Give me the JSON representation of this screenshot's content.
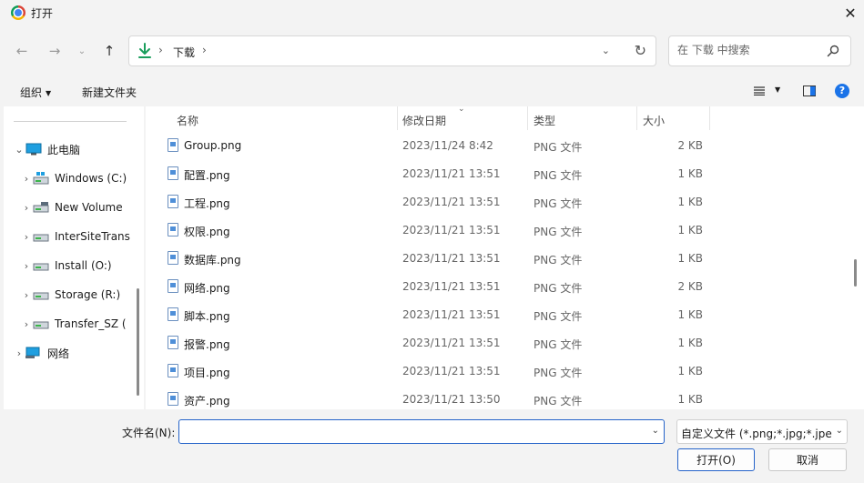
{
  "window": {
    "title": "打开"
  },
  "address": {
    "path": [
      "下载"
    ]
  },
  "search": {
    "placeholder": "在 下载 中搜索"
  },
  "toolbar": {
    "organize": "组织",
    "new_folder": "新建文件夹"
  },
  "sidebar": {
    "items": [
      {
        "label": "此电脑",
        "icon": "monitor-icon",
        "expanded": true
      },
      {
        "label": "Windows (C:)",
        "icon": "windows-drive-icon"
      },
      {
        "label": "New Volume",
        "icon": "drive-icon"
      },
      {
        "label": "InterSiteTrans",
        "icon": "drive-icon"
      },
      {
        "label": "Install (O:)",
        "icon": "drive-icon"
      },
      {
        "label": "Storage (R:)",
        "icon": "drive-icon"
      },
      {
        "label": "Transfer_SZ (",
        "icon": "drive-icon"
      },
      {
        "label": "网络",
        "icon": "network-icon"
      }
    ]
  },
  "columns": {
    "name": "名称",
    "date": "修改日期",
    "type": "类型",
    "size": "大小"
  },
  "files": [
    {
      "name": "Group.png",
      "date": "2023/11/24 8:42",
      "type": "PNG 文件",
      "size": "2 KB"
    },
    {
      "name": "配置.png",
      "date": "2023/11/21 13:51",
      "type": "PNG 文件",
      "size": "1 KB"
    },
    {
      "name": "工程.png",
      "date": "2023/11/21 13:51",
      "type": "PNG 文件",
      "size": "1 KB"
    },
    {
      "name": "权限.png",
      "date": "2023/11/21 13:51",
      "type": "PNG 文件",
      "size": "1 KB"
    },
    {
      "name": "数据库.png",
      "date": "2023/11/21 13:51",
      "type": "PNG 文件",
      "size": "1 KB"
    },
    {
      "name": "网络.png",
      "date": "2023/11/21 13:51",
      "type": "PNG 文件",
      "size": "2 KB"
    },
    {
      "name": "脚本.png",
      "date": "2023/11/21 13:51",
      "type": "PNG 文件",
      "size": "1 KB"
    },
    {
      "name": "报警.png",
      "date": "2023/11/21 13:51",
      "type": "PNG 文件",
      "size": "1 KB"
    },
    {
      "name": "项目.png",
      "date": "2023/11/21 13:51",
      "type": "PNG 文件",
      "size": "1 KB"
    },
    {
      "name": "资产.png",
      "date": "2023/11/21 13:50",
      "type": "PNG 文件",
      "size": "1 KB"
    }
  ],
  "bottom": {
    "filename_label": "文件名(N):",
    "filename_value": "",
    "filter": "自定义文件 (*.png;*.jpg;*.jpeg",
    "open": "打开(O)",
    "cancel": "取消"
  },
  "colors": {
    "accent": "#2563c9",
    "download_green": "#1a9e5c",
    "help_blue": "#1a73e8"
  }
}
